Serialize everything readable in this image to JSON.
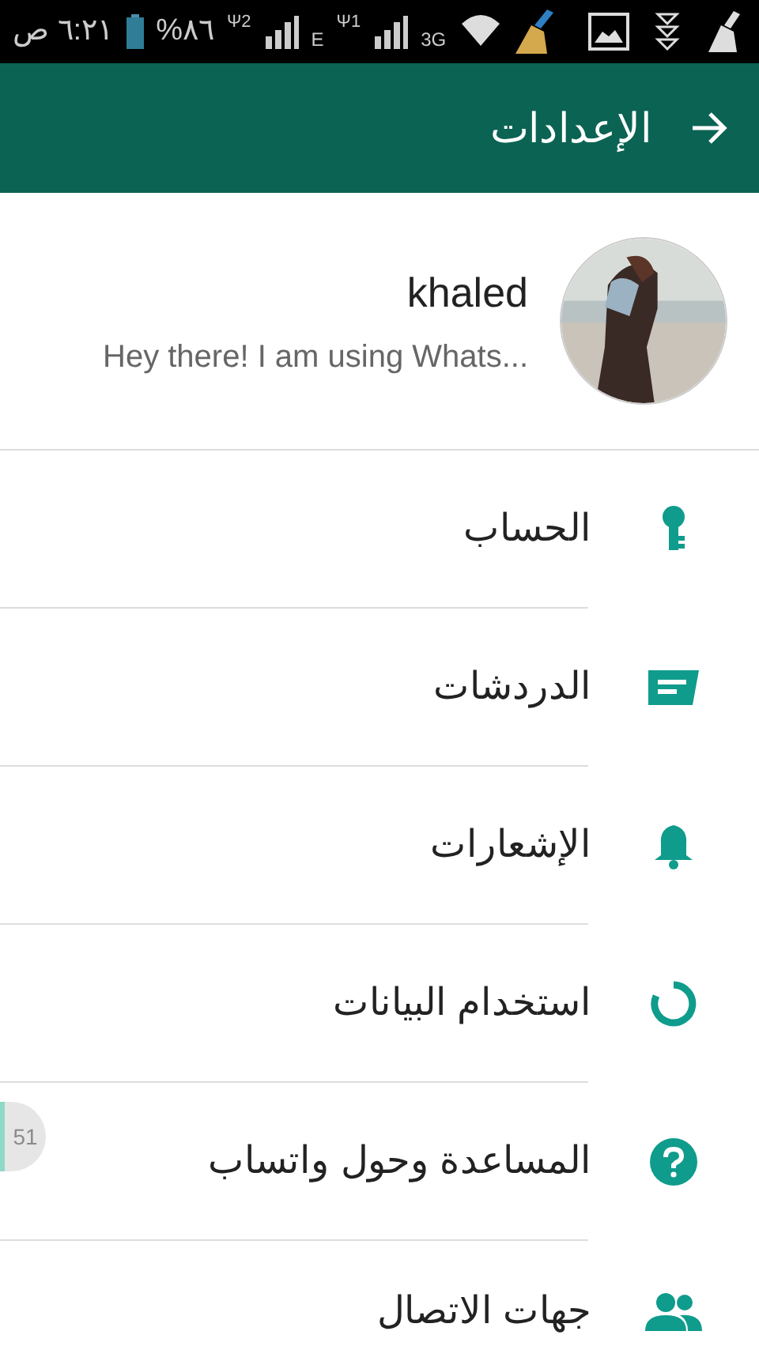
{
  "status_bar": {
    "time": "٦:٢١ ص",
    "battery": "%٨٦",
    "sim_2": "Ψ2",
    "network_2": "E",
    "sim_1": "Ψ1",
    "network_1": "3G"
  },
  "header": {
    "title": "الإعدادات"
  },
  "profile": {
    "name": "khaled",
    "about": "Hey there! I am using Whats..."
  },
  "items": [
    {
      "label": "الحساب",
      "kind": "key"
    },
    {
      "label": "الدردشات",
      "kind": "chat"
    },
    {
      "label": "الإشعارات",
      "kind": "bell"
    },
    {
      "label": "استخدام البيانات",
      "kind": "data"
    },
    {
      "label": "المساعدة وحول واتساب",
      "kind": "help"
    },
    {
      "label": "جهات الاتصال",
      "kind": "contacts"
    }
  ],
  "floating_bubble": {
    "count": "51"
  }
}
